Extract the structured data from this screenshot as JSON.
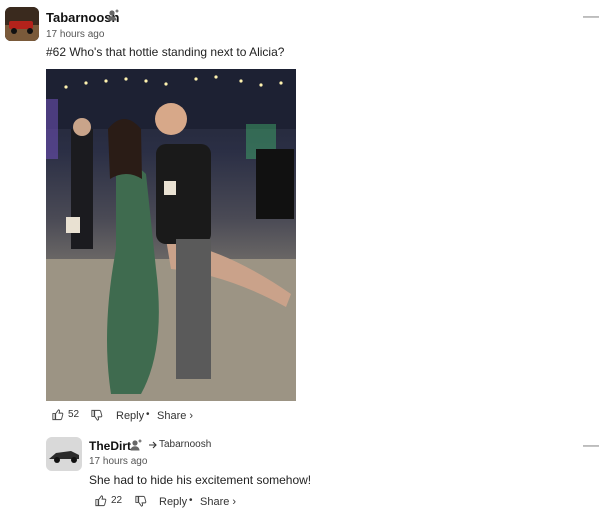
{
  "comments": [
    {
      "username": "Tabarnoosh",
      "time": "17 hours ago",
      "text": "#62 Who's that hottie standing next to Alicia?",
      "likes": "52",
      "reply_label": "Reply",
      "share_label": "Share",
      "share_chevron": "›",
      "collapse_label": "—"
    }
  ],
  "reply": {
    "username": "TheDirt",
    "reply_to": "Tabarnoosh",
    "time": "17 hours ago",
    "text": "She had to hide his excitement somehow!",
    "likes": "22",
    "reply_label": "Reply",
    "share_label": "Share",
    "share_chevron": "›",
    "collapse_label": "—"
  },
  "ui": {
    "separator": "•"
  }
}
